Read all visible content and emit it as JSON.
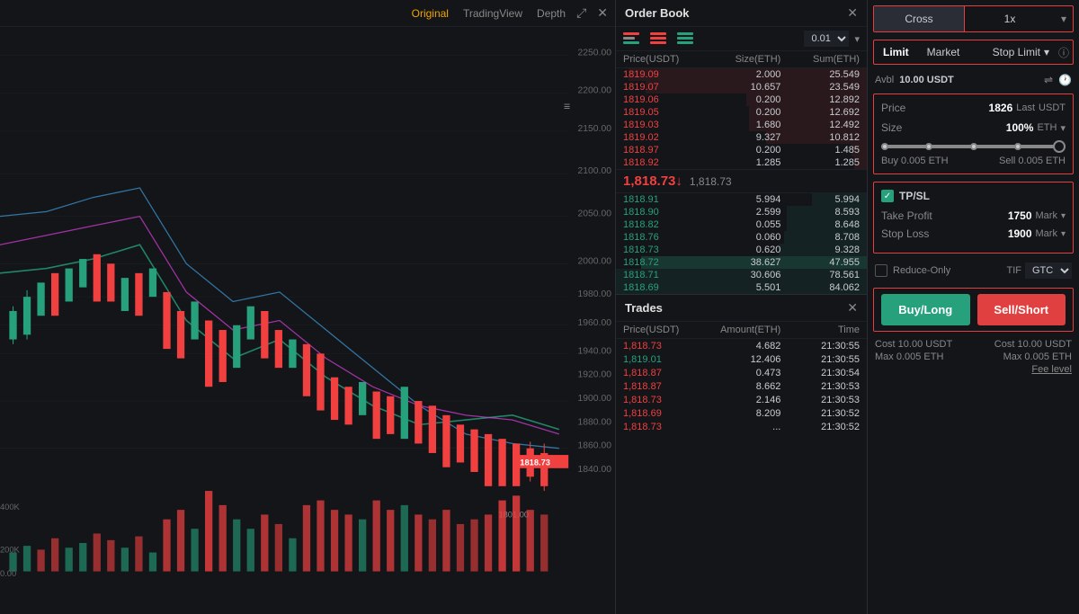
{
  "chart": {
    "tabs": [
      "Original",
      "TradingView",
      "Depth"
    ],
    "active_tab": "Original",
    "price_levels": [
      "2250.00",
      "2200.00",
      "2150.00",
      "2100.00",
      "2050.00",
      "2000.00",
      "1980.00",
      "1960.00",
      "1940.00",
      "1920.00",
      "1900.00",
      "1880.00",
      "1860.00",
      "1840.00"
    ],
    "current_price": "1818.73",
    "volume_levels": [
      "400K",
      "200K",
      "0.00"
    ]
  },
  "order_book": {
    "title": "Order Book",
    "size_option": "0.01",
    "columns": {
      "price": "Price(USDT)",
      "size": "Size(ETH)",
      "sum": "Sum(ETH)"
    },
    "asks": [
      {
        "price": "1819.09",
        "size": "2.000",
        "sum": "25.549",
        "bg_pct": 95
      },
      {
        "price": "1819.07",
        "size": "10.657",
        "sum": "23.549",
        "bg_pct": 88
      },
      {
        "price": "1819.06",
        "size": "0.200",
        "sum": "12.892",
        "bg_pct": 48
      },
      {
        "price": "1819.05",
        "size": "0.200",
        "sum": "12.692",
        "bg_pct": 47
      },
      {
        "price": "1819.03",
        "size": "1.680",
        "sum": "12.492",
        "bg_pct": 47
      },
      {
        "price": "1819.02",
        "size": "9.327",
        "sum": "10.812",
        "bg_pct": 40
      },
      {
        "price": "1818.97",
        "size": "0.200",
        "sum": "1.485",
        "bg_pct": 6
      },
      {
        "price": "1818.92",
        "size": "1.285",
        "sum": "1.285",
        "bg_pct": 5
      }
    ],
    "mid_price": "1,818.73",
    "mid_price_secondary": "1,818.73",
    "mid_price_arrow": "↓",
    "bids": [
      {
        "price": "1818.91",
        "size": "5.994",
        "sum": "5.994",
        "bg_pct": 22
      },
      {
        "price": "1818.90",
        "size": "2.599",
        "sum": "8.593",
        "bg_pct": 32
      },
      {
        "price": "1818.82",
        "size": "0.055",
        "sum": "8.648",
        "bg_pct": 32
      },
      {
        "price": "1818.76",
        "size": "0.060",
        "sum": "8.708",
        "bg_pct": 33
      },
      {
        "price": "1818.73",
        "size": "0.620",
        "sum": "9.328",
        "bg_pct": 35
      },
      {
        "price": "1818.72",
        "size": "38.627",
        "sum": "47.955",
        "bg_pct": 90,
        "highlight": true
      },
      {
        "price": "1818.71",
        "size": "30.606",
        "sum": "78.561",
        "bg_pct": 100
      },
      {
        "price": "1818.69",
        "size": "5.501",
        "sum": "84.062",
        "bg_pct": 100
      }
    ]
  },
  "trades": {
    "title": "Trades",
    "columns": {
      "price": "Price(USDT)",
      "amount": "Amount(ETH)",
      "time": "Time"
    },
    "rows": [
      {
        "price": "1,818.73",
        "amount": "4.682",
        "time": "21:30:55",
        "side": "sell"
      },
      {
        "price": "1,819.01",
        "amount": "12.406",
        "time": "21:30:55",
        "side": "buy"
      },
      {
        "price": "1,818.87",
        "amount": "0.473",
        "time": "21:30:54",
        "side": "sell"
      },
      {
        "price": "1,818.87",
        "amount": "8.662",
        "time": "21:30:53",
        "side": "sell"
      },
      {
        "price": "1,818.73",
        "amount": "2.146",
        "time": "21:30:53",
        "side": "sell"
      },
      {
        "price": "1,818.69",
        "amount": "8.209",
        "time": "21:30:52",
        "side": "sell"
      },
      {
        "price": "1,818.73",
        "amount": "...",
        "time": "21:30:52",
        "side": "sell"
      }
    ]
  },
  "trading_panel": {
    "margin_mode": "Cross",
    "leverage": "1x",
    "order_types": [
      "Limit",
      "Market",
      "Stop Limit"
    ],
    "active_order_type": "Limit",
    "available_label": "Avbl",
    "available_value": "10.00",
    "available_currency": "USDT",
    "price_label": "Price",
    "price_value": "1826",
    "price_tag": "Last",
    "price_currency": "USDT",
    "size_label": "Size",
    "size_value": "100%",
    "size_currency": "ETH",
    "buy_label": "Buy 0.005 ETH",
    "sell_label": "Sell 0.005 ETH",
    "tpsl": {
      "label": "TP/SL",
      "take_profit_label": "Take Profit",
      "take_profit_value": "1750",
      "take_profit_tag": "Mark",
      "stop_loss_label": "Stop Loss",
      "stop_loss_value": "1900",
      "stop_loss_tag": "Mark"
    },
    "reduce_only_label": "Reduce-Only",
    "tif_label": "TIF",
    "tif_value": "GTC",
    "buy_button": "Buy/Long",
    "sell_button": "Sell/Short",
    "cost_buy_label": "Cost 10.00 USDT",
    "cost_sell_label": "Cost 10.00 USDT",
    "max_buy_label": "Max 0.005 ETH",
    "max_sell_label": "Max 0.005 ETH",
    "fee_level_label": "Fee level"
  }
}
